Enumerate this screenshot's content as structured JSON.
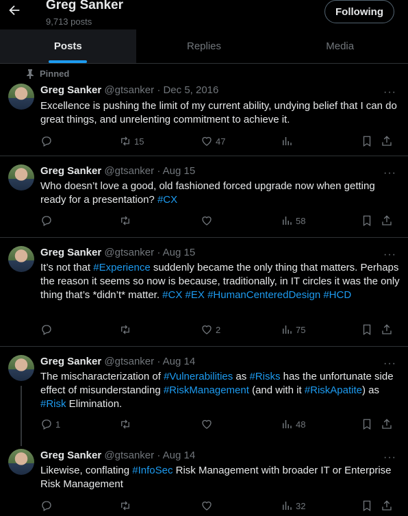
{
  "header": {
    "name": "Greg Sanker",
    "posts_count": "9,713 posts",
    "follow_label": "Following"
  },
  "tabs": [
    {
      "label": "Posts"
    },
    {
      "label": "Replies"
    },
    {
      "label": "Media"
    }
  ],
  "pinned_label": "Pinned",
  "tweets": [
    {
      "author": "Greg Sanker",
      "handle_date": "@gtsanker · Dec 5, 2016",
      "text_plain": "Excellence is pushing the limit of my current ability, undying belief that I can do great things, and unrelenting commitment to achieve it.",
      "reply": "",
      "retweet": "15",
      "like": "47",
      "views": ""
    },
    {
      "author": "Greg Sanker",
      "handle_date": "@gtsanker · Aug 15",
      "text_pre": "Who doesn’t love a good, old fashioned forced upgrade now when getting ready for a presentation? ",
      "tag1": "#CX",
      "reply": "",
      "retweet": "",
      "like": "",
      "views": "58"
    },
    {
      "author": "Greg Sanker",
      "handle_date": "@gtsanker · Aug 15",
      "t1": "It’s not that ",
      "tag1": "#Experience",
      "t2": " suddenly became the only thing that matters. Perhaps the reason it seems so now is because, traditionally, in IT circles it was the only thing that’s *didn’t* matter. ",
      "tag2": "#CX",
      "tag3": "#EX",
      "tag4": "#HumanCenteredDesign",
      "tag5": "#HCD",
      "reply": "",
      "retweet": "",
      "like": "2",
      "views": "75"
    },
    {
      "author": "Greg Sanker",
      "handle_date": "@gtsanker · Aug 14",
      "t1": "The mischaracterization of ",
      "tag1": "#Vulnerabilities",
      "t2": " as ",
      "tag2": "#Risks",
      "t3": " has the unfortunate side effect of misunderstanding ",
      "tag3": "#RiskManagement",
      "t4": " (and with it ",
      "tag4": "#RiskApatite",
      "t5": ") as ",
      "tag5": "#Risk",
      "t6": " Elimination.",
      "reply": "1",
      "retweet": "",
      "like": "",
      "views": "48"
    },
    {
      "author": "Greg Sanker",
      "handle_date": "@gtsanker · Aug 14",
      "t1": "Likewise, conflating ",
      "tag1": "#InfoSec",
      "t2": " Risk Management with broader IT or Enterprise Risk Management",
      "reply": "",
      "retweet": "",
      "like": "",
      "views": "32"
    }
  ],
  "colors": {
    "background": "#000000",
    "text": "#e7e9ea",
    "muted": "#71767b",
    "accent": "#1d9bf0",
    "divider": "#2f3336"
  },
  "icons": [
    "back-arrow-icon",
    "pin-icon",
    "reply-icon",
    "retweet-icon",
    "like-icon",
    "views-icon",
    "bookmark-icon",
    "share-icon",
    "more-icon"
  ]
}
